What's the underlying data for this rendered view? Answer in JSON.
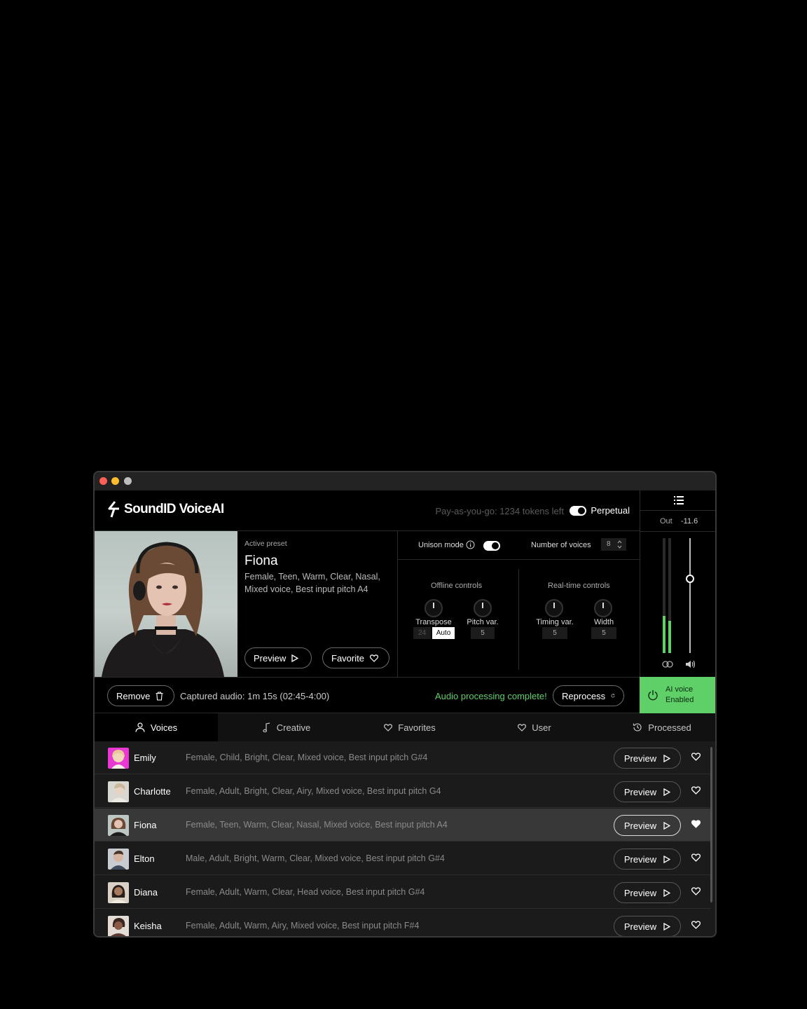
{
  "app": {
    "name": "SoundID VoiceAI",
    "tokens_text": "Pay-as-you-go: 1234 tokens left",
    "perpetual_label": "Perpetual"
  },
  "output": {
    "label": "Out",
    "value": "-11.6",
    "meter_level": 0.4
  },
  "preset": {
    "heading": "Active preset",
    "name": "Fiona",
    "desc_line1": "Female, Teen, Warm, Clear, Nasal,",
    "desc_line2": "Mixed voice, Best input pitch A4",
    "preview_label": "Preview",
    "favorite_label": "Favorite"
  },
  "controls": {
    "unison_label": "Unison mode",
    "voices_label": "Number of voices",
    "voices_value": "8",
    "offline_title": "Offline controls",
    "realtime_title": "Real-time controls",
    "transpose_label": "Transpose",
    "transpose_value": "24",
    "transpose_auto": "Auto",
    "pitchvar_label": "Pitch var.",
    "pitchvar_value": "5",
    "timingvar_label": "Timing var.",
    "timingvar_value": "5",
    "width_label": "Width",
    "width_value": "5"
  },
  "status": {
    "remove_label": "Remove",
    "captured_text": "Captured audio: 1m 15s (02:45-4:00)",
    "complete_text": "Audio processing complete!",
    "reprocess_label": "Reprocess",
    "ai_line1": "AI voice",
    "ai_line2": "Enabled"
  },
  "tabs": [
    {
      "label": "Voices"
    },
    {
      "label": "Creative"
    },
    {
      "label": "Favorites"
    },
    {
      "label": "User"
    },
    {
      "label": "Processed"
    }
  ],
  "voices": [
    {
      "name": "Emily",
      "desc": "Female, Child, Bright, Clear, Mixed voice, Best input pitch G#4",
      "preview": "Preview"
    },
    {
      "name": "Charlotte",
      "desc": "Female, Adult, Bright, Clear, Airy, Mixed voice, Best input pitch  G4",
      "preview": "Preview"
    },
    {
      "name": "Fiona",
      "desc": "Female, Teen, Warm, Clear, Nasal, Mixed voice, Best input pitch  A4",
      "preview": "Preview"
    },
    {
      "name": "Elton",
      "desc": "Male, Adult, Bright, Warm, Clear, Mixed voice, Best input pitch  G#4",
      "preview": "Preview"
    },
    {
      "name": "Diana",
      "desc": "Female, Adult, Warm, Clear, Head voice, Best input pitch  G#4",
      "preview": "Preview"
    },
    {
      "name": "Keisha",
      "desc": "Female, Adult, Warm, Airy, Mixed voice, Best input pitch  F#4",
      "preview": "Preview"
    }
  ],
  "colors": {
    "accent_green": "#5fd068",
    "active_row": "#383838"
  }
}
